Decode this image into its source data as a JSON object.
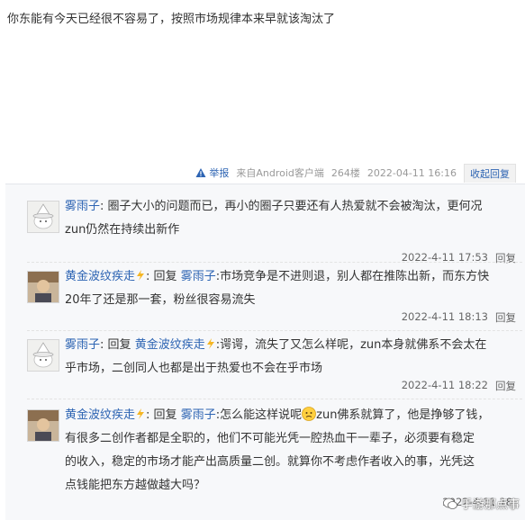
{
  "post": {
    "text": "你东能有今天已经很不容易了，按照市场规律本来早就该淘汰了",
    "meta": {
      "report": "举报",
      "client": "来自Android客户端",
      "floor": "264楼",
      "time": "2022-04-11 16:16",
      "collapse": "收起回复"
    }
  },
  "replies": [
    {
      "user": "雾雨子",
      "reply_prefix": "",
      "reply_to": "",
      "sep": ":",
      "lines": [
        "圈子大小的问题而已，再小的圈子只要还有人热爱就不会被淘汰，更何况",
        "zun仍然在持续出新作"
      ],
      "time": "2022-4-11 17:53",
      "reply_btn": "回复",
      "avatar": "hat"
    },
    {
      "user": "黄金波纹疾走",
      "reply_prefix": "回复",
      "reply_to": "雾雨子",
      "sep": ":",
      "lines": [
        "市场竞争是不进则退，别人都在推陈出新，而东方快",
        "20年了还是那一套，粉丝很容易流失"
      ],
      "time": "2022-4-11 18:13",
      "reply_btn": "回复",
      "avatar": "person"
    },
    {
      "user": "雾雨子",
      "reply_prefix": "回复",
      "reply_to": "黄金波纹疾走",
      "sep": ":",
      "lines": [
        "谔谔，流失了又怎么样呢，zun本身就佛系不会太在",
        "乎市场，二创同人也都是出于热爱也不会在乎市场"
      ],
      "time": "2022-4-11 18:22",
      "reply_btn": "回复",
      "avatar": "hat"
    },
    {
      "user": "黄金波纹疾走",
      "reply_prefix": "回复",
      "reply_to": "雾雨子",
      "sep": ":",
      "line1a": "怎么能这样说呢",
      "line1b": "zun佛系就算了，他是挣够了钱，",
      "lines": [
        "有很多二创作者都是全职的，他们不可能光凭一腔热血干一辈子，必须要有稳定",
        "的收入，稳定的市场才能产出高质量二创。就算你不考虑作者收入的事，光凭这",
        "点钱能把东方越做越大吗？"
      ],
      "time": "2022-4-11 18:",
      "reply_btn": "回复",
      "avatar": "person"
    }
  ],
  "watermark": "手游那点事",
  "colors": {
    "link": "#2d64b3",
    "meta": "#999999",
    "panel": "#f7f8fa",
    "level": "#f5b623"
  }
}
